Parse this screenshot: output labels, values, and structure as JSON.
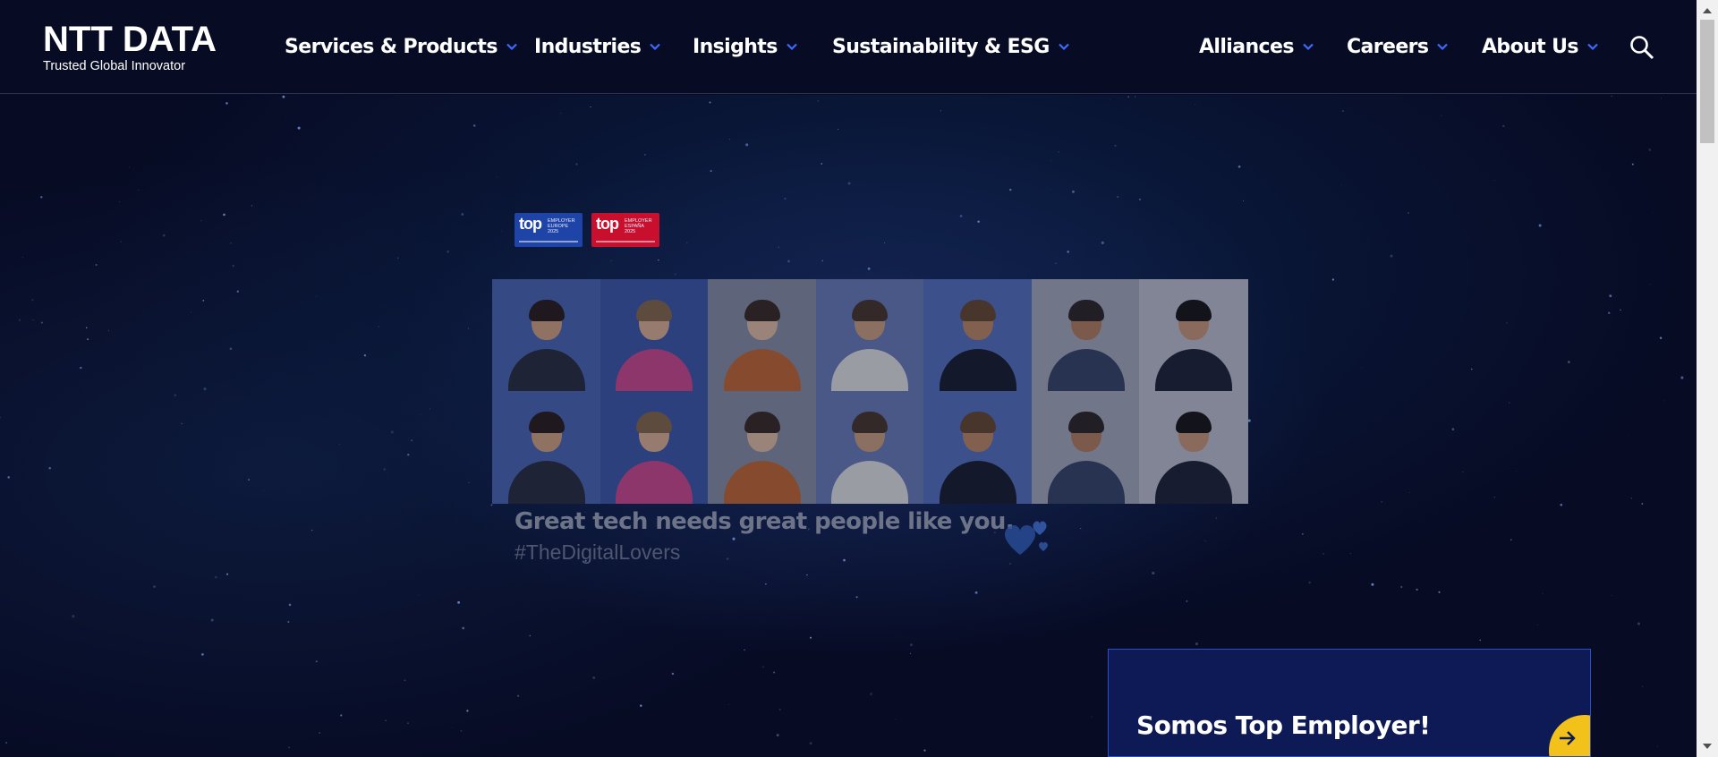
{
  "header": {
    "logo": {
      "wordmark": "NTT DATA",
      "tagline": "Trusted Global Innovator"
    },
    "nav_left": [
      {
        "label": "Services & Products"
      },
      {
        "label": "Industries"
      },
      {
        "label": "Insights"
      },
      {
        "label": "Sustainability & ESG"
      }
    ],
    "nav_right": [
      {
        "label": "Alliances"
      },
      {
        "label": "Careers"
      },
      {
        "label": "About Us"
      }
    ],
    "search_icon": "search-icon",
    "chevron_icon": "chevron-down-icon",
    "chevron_color": "#3d6bff"
  },
  "hero": {
    "badges": [
      {
        "top": "top",
        "sub": "EMPLOYER\nEUROPE\n2025",
        "color": "#1f44a7"
      },
      {
        "top": "top",
        "sub": "EMPLOYER\nESPAÑA\n2025",
        "color": "#c8102e"
      }
    ],
    "tagline": "Great tech needs great people like you.",
    "hashtag": "#TheDigitalLovers",
    "hearts_icon": "hearts-icon",
    "photo_grid_rows": 2,
    "photo_grid_cols": 7
  },
  "promo": {
    "title": "Somos Top Employer!",
    "arrow_icon": "arrow-right-icon",
    "accent": "#f2c21b"
  },
  "colors": {
    "background": "#070b24",
    "promo_bg": "#0d1a55",
    "promo_border": "#2c4ec9"
  }
}
